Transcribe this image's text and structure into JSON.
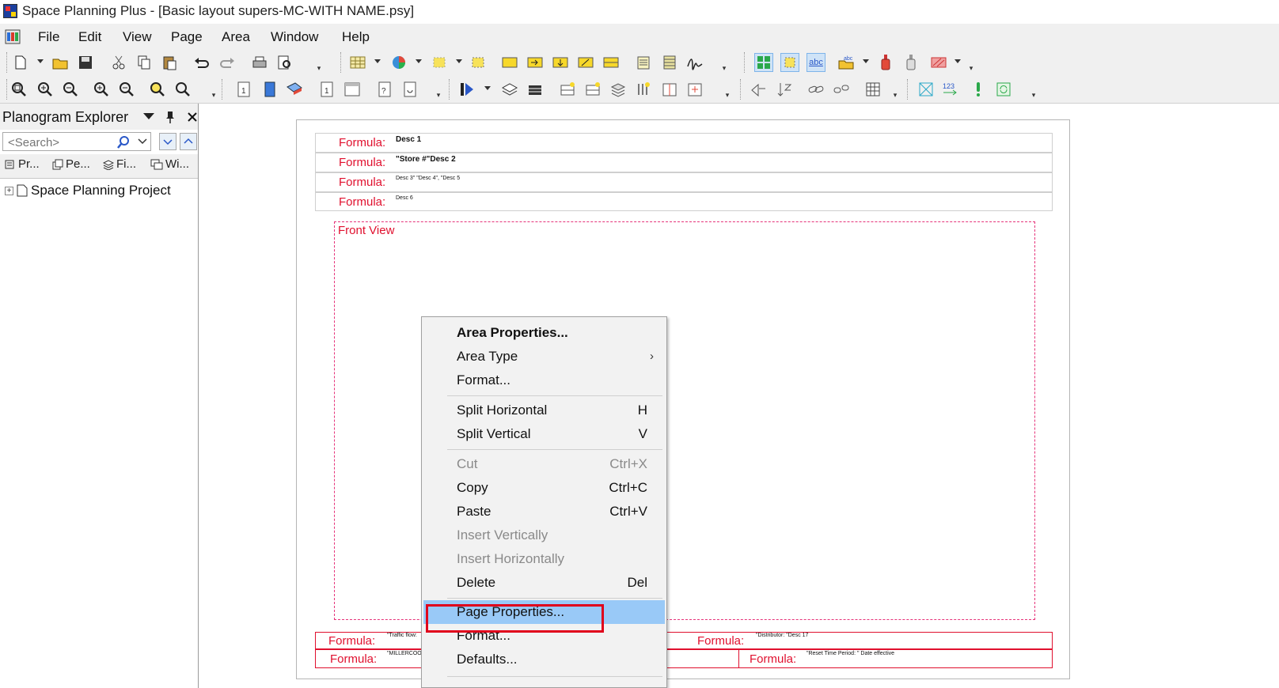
{
  "window": {
    "title": "Space Planning Plus - [Basic layout supers-MC-WITH NAME.psy]"
  },
  "menubar": {
    "items": [
      "File",
      "Edit",
      "View",
      "Page",
      "Area",
      "Window",
      "Help"
    ]
  },
  "explorer": {
    "title": "Planogram Explorer",
    "search_placeholder": "<Search>",
    "tabs": [
      "Pr...",
      "Pe...",
      "Fi...",
      "Wi..."
    ],
    "tree": [
      {
        "label": "Space Planning Project",
        "expander": "+"
      }
    ]
  },
  "page": {
    "header_rows": [
      {
        "label": "Formula:",
        "value": "Desc 1"
      },
      {
        "label": "Formula:",
        "value": "\"Store #\"Desc 2"
      },
      {
        "label": "Formula:",
        "value": "Desc 3\"     \"Desc 4\", \"Desc 5"
      },
      {
        "label": "Formula:",
        "value": "Desc 6"
      }
    ],
    "front_view_label": "Front View",
    "footer_rows": [
      {
        "left_label": "Formula:",
        "left_value": "\"Traffic flow:",
        "right_label": "Formula:",
        "right_value": "\"Distributor: \"Desc 17"
      },
      {
        "left_label": "Formula:",
        "left_value": "\"MILLERCOO",
        "right_label": "Formula:",
        "right_value": "\"Reset Time Period: \" Date effective"
      }
    ]
  },
  "context_menu": {
    "items": [
      {
        "label": "Area Properties...",
        "shortcut": "",
        "bold": true
      },
      {
        "label": "Area Type",
        "shortcut": "",
        "submenu_arrow": "›"
      },
      {
        "label": "Format...",
        "shortcut": ""
      },
      {
        "label": "Split Horizontal",
        "shortcut": "H"
      },
      {
        "label": "Split Vertical",
        "shortcut": "V"
      },
      {
        "label": "Cut",
        "shortcut": "Ctrl+X",
        "disabled": true
      },
      {
        "label": "Copy",
        "shortcut": "Ctrl+C"
      },
      {
        "label": "Paste",
        "shortcut": "Ctrl+V"
      },
      {
        "label": "Insert Vertically",
        "shortcut": "",
        "disabled": true
      },
      {
        "label": "Insert Horizontally",
        "shortcut": "",
        "disabled": true
      },
      {
        "label": "Delete",
        "shortcut": "Del"
      },
      {
        "label": "Page Properties...",
        "shortcut": "",
        "highlighted": true
      },
      {
        "label": "Format...",
        "shortcut": ""
      },
      {
        "label": "Defaults...",
        "shortcut": ""
      }
    ]
  },
  "colors": {
    "accent_red": "#e0102e",
    "highlight": "#99c9f7",
    "frontview_border": "#e6337a"
  }
}
